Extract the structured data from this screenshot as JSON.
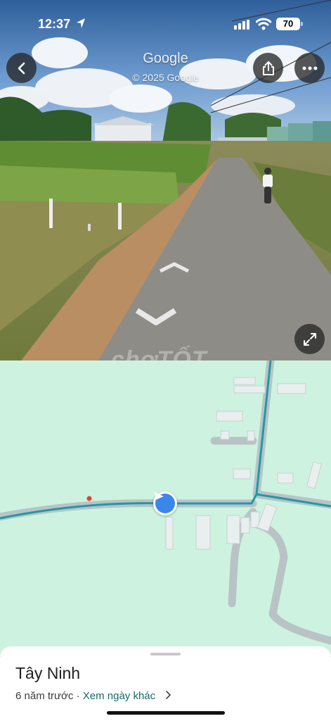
{
  "status_bar": {
    "time": "12:37",
    "battery": "70"
  },
  "street_view": {
    "title": "Google",
    "copyright": "© 2025 Google",
    "watermark": "chợTỐT"
  },
  "icons": {
    "back": "chevron-left-icon",
    "share": "share-icon",
    "more": "more-horizontal-icon",
    "expand": "expand-icon",
    "direction": "navigation-arrow-icon"
  },
  "map": {
    "road_color": "#1e9aa6",
    "background_color": "#cdf3e0",
    "marker_color": "#3a86ea"
  },
  "sheet": {
    "place": "Tây Ninh",
    "age": "6 năm trước",
    "separator": " · ",
    "other_dates": "Xem ngày khác"
  }
}
